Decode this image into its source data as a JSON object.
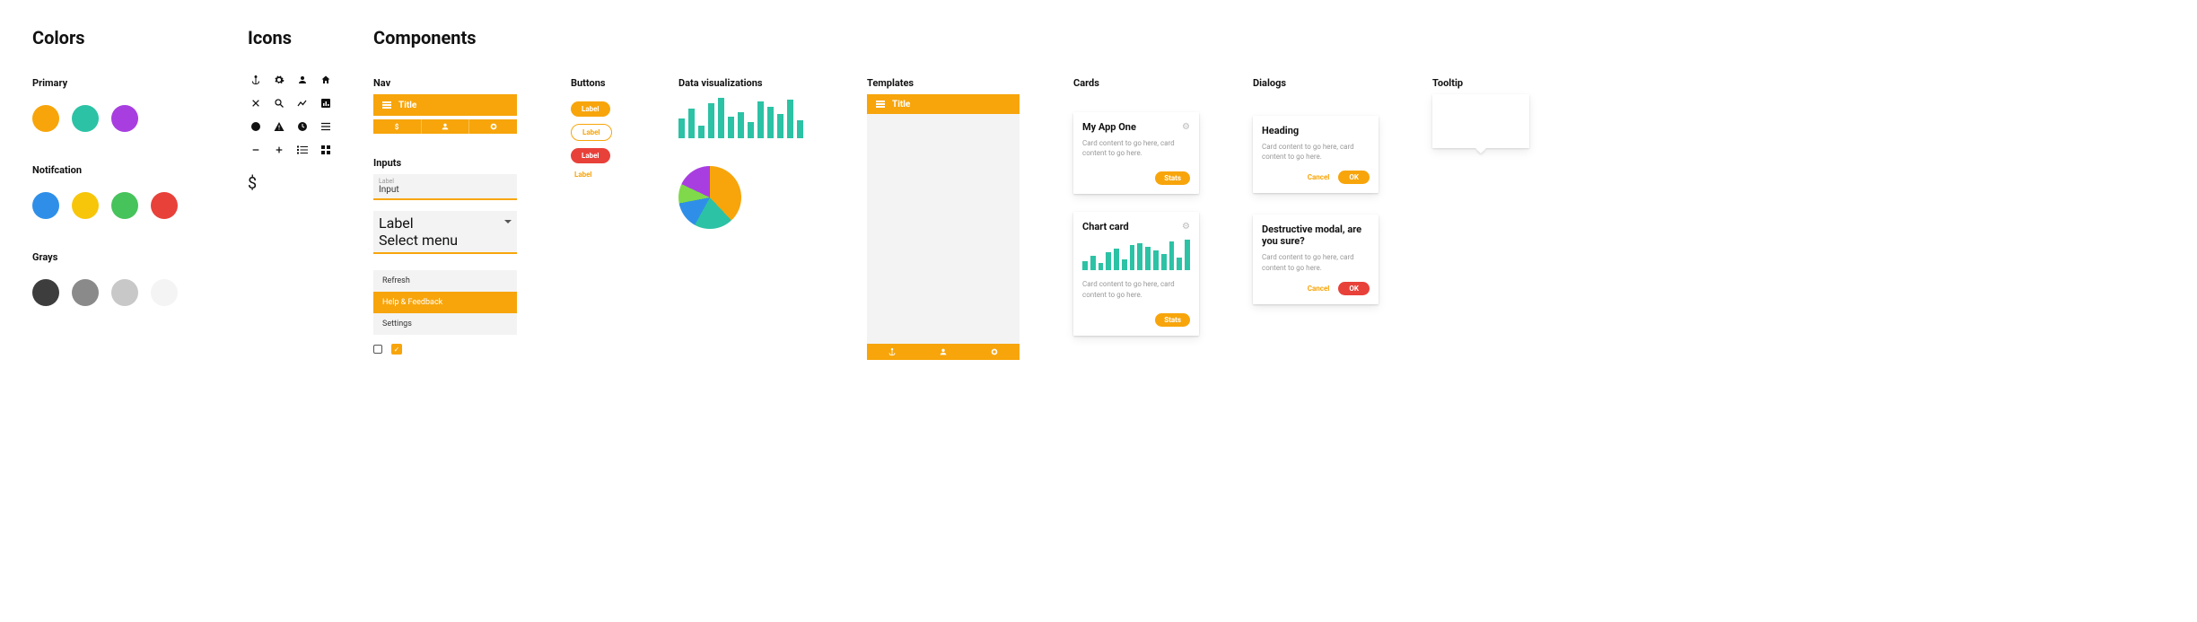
{
  "headings": {
    "colors": "Colors",
    "icons": "Icons",
    "components": "Components"
  },
  "colors": {
    "primary_label": "Primary",
    "primary": [
      "#f7a50b",
      "#2cc2a5",
      "#a83ee0"
    ],
    "notification_label": "Notifcation",
    "notification": [
      "#2f8fe8",
      "#f7c60b",
      "#46c35b",
      "#e8413a"
    ],
    "grays_label": "Grays",
    "grays": [
      "#3d3d3d",
      "#8a8a8a",
      "#c8c8c8",
      "#f4f4f4"
    ]
  },
  "icons": {
    "row1": [
      "anchor",
      "gear",
      "person",
      "home"
    ],
    "row2": [
      "close",
      "search",
      "trend",
      "bar-chart"
    ],
    "row3": [
      "pie-chart",
      "warning",
      "clock",
      "list"
    ],
    "row4": [
      "minus",
      "plus",
      "ordered-list",
      "grid"
    ],
    "dollar": "$"
  },
  "components": {
    "nav": {
      "label": "Nav",
      "title": "Title",
      "tabs": [
        "dollar",
        "person",
        "gear"
      ]
    },
    "inputs": {
      "label": "Inputs",
      "text": {
        "label": "Label",
        "value": "Input"
      },
      "select": {
        "label": "Label",
        "value": "Select menu"
      },
      "menu": [
        "Refresh",
        "Help & Feedback",
        "Settings"
      ],
      "menu_active_index": 1
    },
    "buttons": {
      "label": "Buttons",
      "items": [
        "Label",
        "Label",
        "Label",
        "Label"
      ]
    },
    "viz": {
      "label": "Data visualizations"
    },
    "templates": {
      "label": "Templates",
      "title": "Title"
    },
    "cards": {
      "label": "Cards",
      "card1": {
        "title": "My App One",
        "body": "Card content to go here, card content to go here.",
        "action": "Stats"
      },
      "card2": {
        "title": "Chart card",
        "body": "Card content to go here, card content to go here.",
        "action": "Stats"
      }
    },
    "dialogs": {
      "label": "Dialogs",
      "d1": {
        "title": "Heading",
        "body": "Card content to go here, card content to go here.",
        "cancel": "Cancel",
        "ok": "OK"
      },
      "d2": {
        "title": "Destructive modal, are you sure?",
        "body": "Card content to go here, card content to go here.",
        "cancel": "Cancel",
        "ok": "OK"
      }
    },
    "tooltip": {
      "label": "Tooltip"
    }
  },
  "chart_data": [
    {
      "type": "bar",
      "name": "demo-bar-chart",
      "values": [
        22,
        34,
        14,
        40,
        46,
        24,
        30,
        18,
        42,
        36,
        28,
        44,
        20
      ],
      "ylim": [
        0,
        50
      ]
    },
    {
      "type": "pie",
      "name": "demo-pie-chart",
      "slices": [
        {
          "color": "#f7a50b",
          "value": 38
        },
        {
          "color": "#2cc2a5",
          "value": 20
        },
        {
          "color": "#2f8fe8",
          "value": 14
        },
        {
          "color": "#7fd94a",
          "value": 10
        },
        {
          "color": "#a83ee0",
          "value": 18
        }
      ]
    },
    {
      "type": "bar",
      "name": "card-mini-bar-chart",
      "values": [
        10,
        16,
        8,
        20,
        24,
        12,
        28,
        30,
        26,
        22,
        18,
        32,
        14,
        34
      ],
      "ylim": [
        0,
        36
      ]
    }
  ]
}
